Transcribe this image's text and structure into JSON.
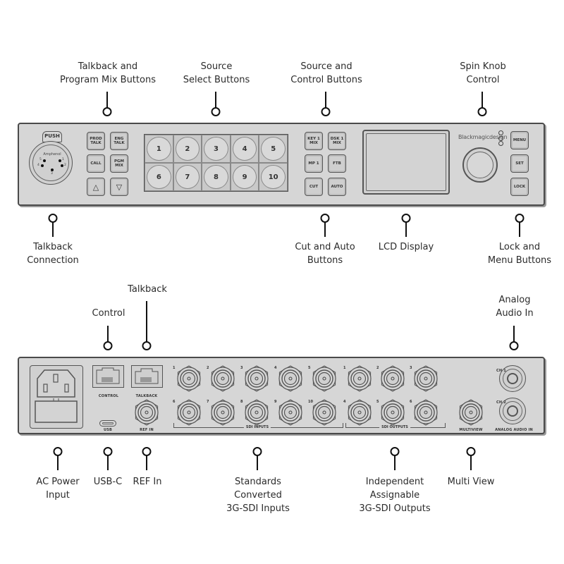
{
  "front_panel": {
    "callouts_top": [
      {
        "id": "talkback-program-mix",
        "lines": [
          "Talkback and",
          "Program Mix Buttons"
        ]
      },
      {
        "id": "source-select",
        "lines": [
          "Source",
          "Select Buttons"
        ]
      },
      {
        "id": "source-control",
        "lines": [
          "Source and",
          "Control  Buttons"
        ]
      },
      {
        "id": "spin-knob",
        "lines": [
          "Spin Knob",
          "Control"
        ]
      }
    ],
    "callouts_bottom": [
      {
        "id": "talkback-connection",
        "lines": [
          "Talkback",
          "Connection"
        ]
      },
      {
        "id": "cut-auto",
        "lines": [
          "Cut and Auto",
          "Buttons"
        ]
      },
      {
        "id": "lcd-display",
        "lines": [
          "LCD Display"
        ]
      },
      {
        "id": "lock-menu",
        "lines": [
          "Lock and",
          "Menu Buttons"
        ]
      }
    ],
    "xlr": {
      "push_label": "PUSH",
      "brand_label": "Amphenol",
      "pin_labels": [
        "1",
        "2",
        "3",
        "4",
        "5"
      ]
    },
    "talkback_buttons": [
      {
        "label": "PROD\nTALK"
      },
      {
        "label": "ENG\nTALK"
      },
      {
        "label": "CALL"
      },
      {
        "label": "PGM\nMIX"
      },
      {
        "label": "△",
        "icon": "arrow-up-icon"
      },
      {
        "label": "▽",
        "icon": "arrow-down-icon"
      }
    ],
    "source_buttons": [
      "1",
      "2",
      "3",
      "4",
      "5",
      "6",
      "7",
      "8",
      "9",
      "10"
    ],
    "control_buttons": [
      {
        "label": "KEY 1\nMIX"
      },
      {
        "label": "DSK 1\nMIX"
      },
      {
        "label": "MP 1"
      },
      {
        "label": "FTB"
      },
      {
        "label": "CUT"
      },
      {
        "label": "AUTO"
      }
    ],
    "brand": "Blackmagicdesign",
    "menu_buttons": [
      {
        "label": "MENU"
      },
      {
        "label": "SET"
      },
      {
        "label": "LOCK"
      }
    ]
  },
  "rear_panel": {
    "callouts_top": [
      {
        "id": "control",
        "lines": [
          "Control"
        ]
      },
      {
        "id": "talkback",
        "lines": [
          "Talkback"
        ]
      },
      {
        "id": "analog-audio-in",
        "lines": [
          "Analog",
          "Audio In"
        ]
      }
    ],
    "callouts_bottom": [
      {
        "id": "ac-power",
        "lines": [
          "AC Power",
          "Input"
        ]
      },
      {
        "id": "usb-c",
        "lines": [
          "USB-C"
        ]
      },
      {
        "id": "ref-in",
        "lines": [
          "REF In"
        ]
      },
      {
        "id": "sdi-inputs",
        "lines": [
          "Standards",
          "Converted",
          "3G-SDI Inputs"
        ]
      },
      {
        "id": "sdi-outputs",
        "lines": [
          "Independent",
          "Assignable",
          "3G-SDI Outputs"
        ]
      },
      {
        "id": "multi-view",
        "lines": [
          "Multi View"
        ]
      }
    ],
    "port_labels": {
      "control": "CONTROL",
      "talkback": "TALKBACK",
      "usb": "USB",
      "ref_in": "REF IN",
      "sdi_inputs": "SDI INPUTS",
      "sdi_outputs": "SDI OUTPUTS",
      "multiview": "MULTIVIEW",
      "analog_audio_in": "ANALOG AUDIO IN",
      "ch1": "CH 1",
      "ch2": "CH 2"
    },
    "sdi_input_numbers": [
      "1",
      "2",
      "3",
      "4",
      "5",
      "6",
      "7",
      "8",
      "9",
      "10"
    ],
    "sdi_output_numbers": [
      "1",
      "2",
      "3",
      "4",
      "5",
      "6"
    ]
  }
}
